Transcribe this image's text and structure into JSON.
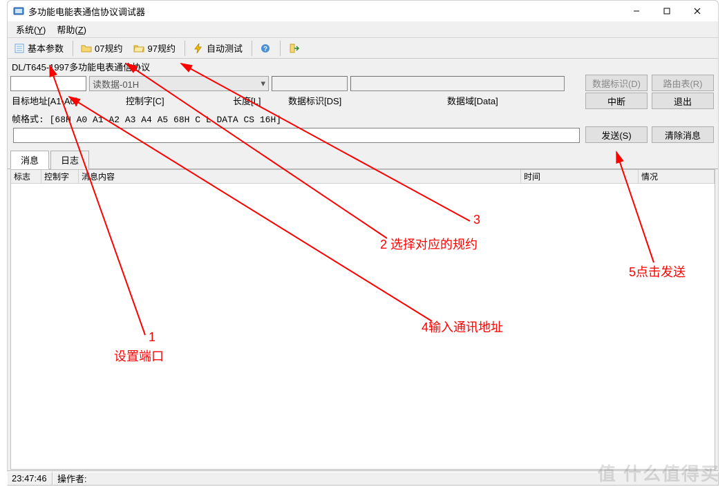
{
  "window": {
    "title": "多功能电能表通信协议调试器"
  },
  "menubar": {
    "system": "系统(",
    "system_key": "Y",
    "system_end": ")",
    "help": "帮助(",
    "help_key": "Z",
    "help_end": ")"
  },
  "toolbar": {
    "basic_params": "基本参数",
    "spec07": "07规约",
    "spec97": "97规约",
    "auto_test": "自动测试"
  },
  "section": {
    "protocol_label": "DL/T645-1997多功能电表通信协议"
  },
  "row1": {
    "combo_read": "读数据-01H"
  },
  "buttons": {
    "data_id": "数据标识(D)",
    "route_table": "路由表(R)",
    "interrupt": "中断",
    "exit": "退出",
    "send": "发送(S)",
    "clear_msg": "清除消息"
  },
  "field_labels": {
    "target_addr": "目标地址[A1-A0]",
    "control": "控制字[C]",
    "length": "长度[L]",
    "data_id": "数据标识[DS]",
    "data_field": "数据域[Data]"
  },
  "frame_format": {
    "prefix": "帧格式: ",
    "value": "[68H A0 A1 A2 A3 A4 A5 68H C L DATA CS 16H]"
  },
  "tabs": {
    "messages": "消息",
    "log": "日志"
  },
  "table_headers": {
    "flag": "标志",
    "control": "控制字",
    "content": "消息内容",
    "time": "时间",
    "status": "情况"
  },
  "statusbar": {
    "time": "23:47:46",
    "operator_label": "操作者: "
  },
  "annotations": {
    "a1_num": "1",
    "a1": "设置端口",
    "a2": "2 选择对应的规约",
    "a3": "3",
    "a4": "4输入通讯地址",
    "a5": "5点击发送"
  },
  "watermark": "值 什么值得买"
}
